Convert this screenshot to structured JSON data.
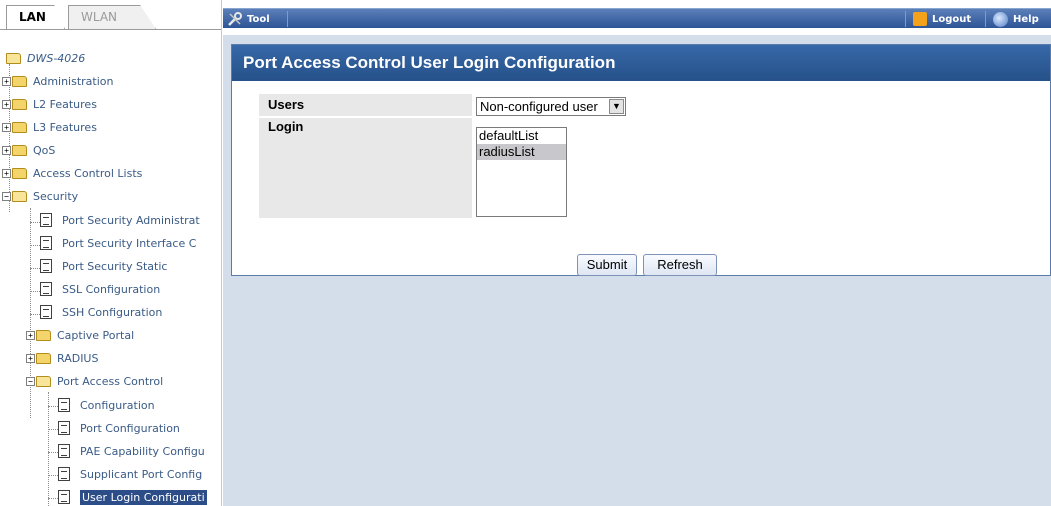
{
  "tabs": [
    "LAN",
    "WLAN"
  ],
  "toolbar": {
    "tool": "Tool",
    "logout": "Logout",
    "help": "Help"
  },
  "tree": {
    "root": "DWS-4026",
    "items": [
      "Administration",
      "L2 Features",
      "L3 Features",
      "QoS",
      "Access Control Lists",
      "Security",
      "Port Security Administrat",
      "Port Security Interface C",
      "Port Security Static",
      "SSL Configuration",
      "SSH Configuration",
      "Captive Portal",
      "RADIUS",
      "Port Access Control",
      "Configuration",
      "Port Configuration",
      "PAE Capability Configu",
      "Supplicant Port Config",
      "User Login Configurati"
    ]
  },
  "panel": {
    "title": "Port Access Control User Login Configuration",
    "users_label": "Users",
    "users_value": "Non-configured user",
    "login_label": "Login",
    "login_options": [
      "defaultList",
      "radiusList"
    ],
    "login_selected": "radiusList",
    "submit": "Submit",
    "refresh": "Refresh"
  },
  "colors": {
    "accent": "#2c5a96",
    "selected_nav": "#2c4d88",
    "content_bg": "#d4deea"
  }
}
